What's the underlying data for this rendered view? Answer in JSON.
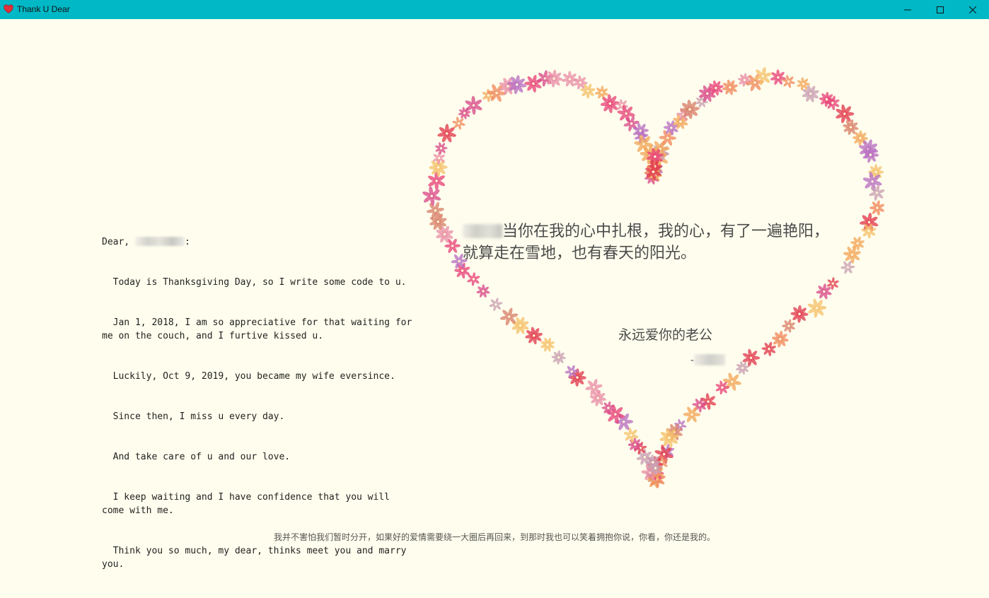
{
  "window": {
    "title": "Thank U Dear",
    "icon": "heart-icon",
    "controls": [
      "minimize-icon",
      "maximize-icon",
      "close-icon"
    ]
  },
  "letter": {
    "greeting_prefix": "Dear, ",
    "greeting_suffix": ":",
    "lines": [
      "  Today is Thanksgiving Day, so I write some code to u.",
      "  Jan 1, 2018, I am so appreciative for that waiting for me on the couch, and I furtive kissed u.",
      "  Luckily, Oct 9, 2019, you became my wife eversince.",
      "  Since then, I miss u every day.",
      "  And take care of u and our love.",
      "  I keep waiting and I have confidence that you will come with me.",
      "  Think you so much, my dear, thinks meet you and marry you."
    ]
  },
  "heart": {
    "poem": "当你在我的心中扎根，我的心，有了一遍艳阳，就算走在雪地，也有春天的阳光。",
    "signature": "永远爱你的老公",
    "signature_dash": "-",
    "flower_colors": [
      "#e8457a",
      "#f08a5d",
      "#d94c8a",
      "#c9a0b4",
      "#f2a65a",
      "#e23b4e",
      "#b86fc2",
      "#e98fa8",
      "#f5c16c",
      "#d9826a"
    ]
  },
  "footer": {
    "text": "我并不害怕我们暂时分开，如果好的爱情需要绕一大圈后再回来，到那时我也可以笑着拥抱你说，你看，你还是我的。"
  }
}
